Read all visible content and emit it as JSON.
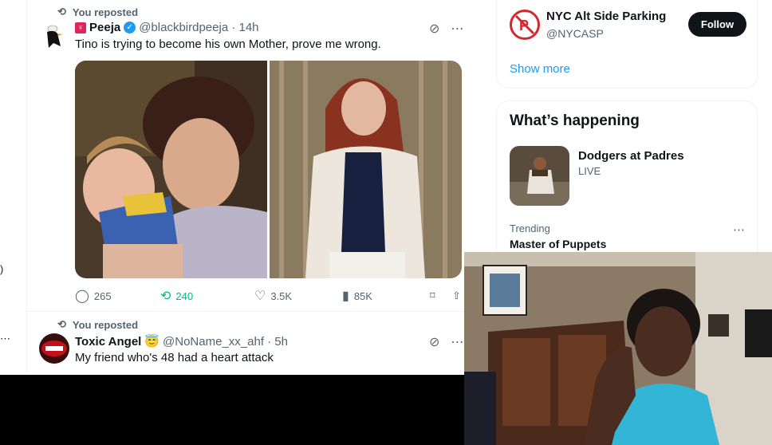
{
  "tweet1": {
    "repost_label": "You reposted",
    "name": "Peeja",
    "handle_time": "@blackbirdpeeja · 14h",
    "text": "Tino is trying to become his own Mother, prove me wrong.",
    "replies": "265",
    "reposts": "240",
    "likes": "3.5K",
    "views": "85K"
  },
  "tweet2": {
    "repost_label": "You reposted",
    "name": "Toxic Angel",
    "emoji": "😇",
    "handle_time": "@NoName_xx_ahf · 5h",
    "text": "My friend who's 48 had a heart attack"
  },
  "who_to_follow": {
    "name": "NYC Alt Side Parking",
    "handle": "@NYCASP",
    "follow_label": "Follow",
    "show_more": "Show more"
  },
  "whats_happening": {
    "title": "What’s happening",
    "event_title": "Dodgers at Padres",
    "event_status": "LIVE",
    "trend_context": "Trending",
    "trend_name": "Master of Puppets"
  },
  "colors": {
    "accent": "#1d9bf0",
    "repost_green": "#00ba7c",
    "text_secondary": "#536471",
    "alt_side_red": "#d6262e"
  }
}
